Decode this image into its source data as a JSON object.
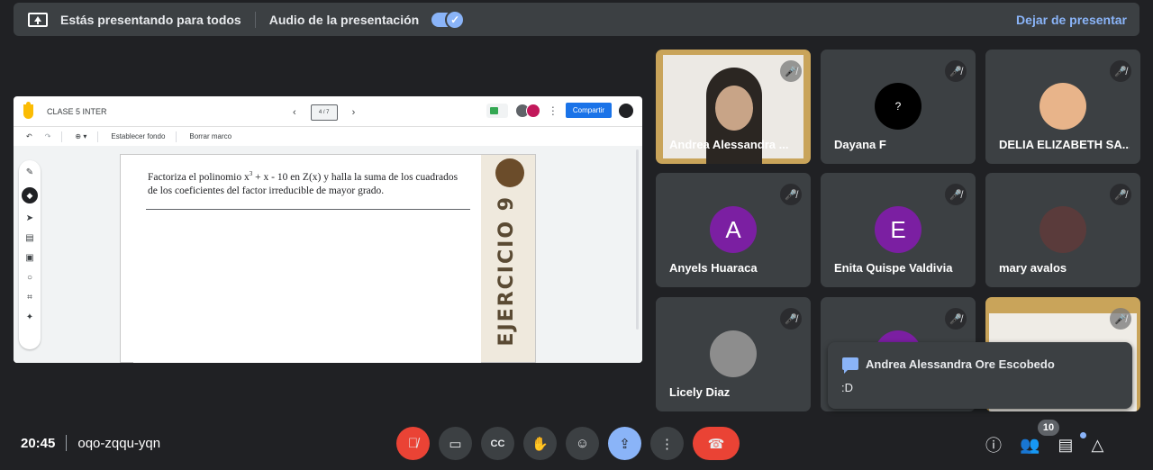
{
  "banner": {
    "presenting_text": "Estás presentando para todos",
    "audio_label": "Audio de la presentación",
    "audio_toggle_on": true,
    "stop_label": "Dejar de presentar"
  },
  "jamboard": {
    "title": "CLASE 5 INTER",
    "frame_indicator": "4 / 7",
    "share_label": "Compartir",
    "toolbar": {
      "set_background": "Establecer fondo",
      "clear_frame": "Borrar marco"
    },
    "problem_text_1": "Factoriza el polinomio x",
    "problem_sup": "3",
    "problem_text_2": " + x - 10 en Z(x) y halla la suma de los cuadrados de los coeficientes del factor irreducible de mayor grado.",
    "side_banner": "EJERCICIO 9"
  },
  "participants": [
    {
      "name": "Andrea Alessandra ...",
      "kind": "video"
    },
    {
      "name": "Dayana F",
      "kind": "avatar",
      "initial": "?",
      "color": "#000000"
    },
    {
      "name": "DELIA ELIZABETH SA...",
      "kind": "photo"
    },
    {
      "name": "Anyels Huaraca",
      "kind": "letter",
      "initial": "A",
      "color": "#7b1fa2"
    },
    {
      "name": "Enita Quispe Valdivia",
      "kind": "letter",
      "initial": "E",
      "color": "#7b1fa2"
    },
    {
      "name": "mary avalos",
      "kind": "photo"
    },
    {
      "name": "Licely Diaz",
      "kind": "photo"
    },
    {
      "name": "",
      "kind": "letter",
      "initial": "",
      "color": "#7b1fa2"
    },
    {
      "name": "",
      "kind": "video"
    }
  ],
  "chat_toast": {
    "sender": "Andrea Alessandra Ore Escobedo",
    "message": ":D"
  },
  "meeting": {
    "time": "20:45",
    "code": "oqo-zqqu-yqn",
    "participant_count": "10"
  },
  "colors": {
    "background": "#202124",
    "accent": "#8ab4f8",
    "danger": "#ea4335",
    "tile": "#3c4043"
  }
}
